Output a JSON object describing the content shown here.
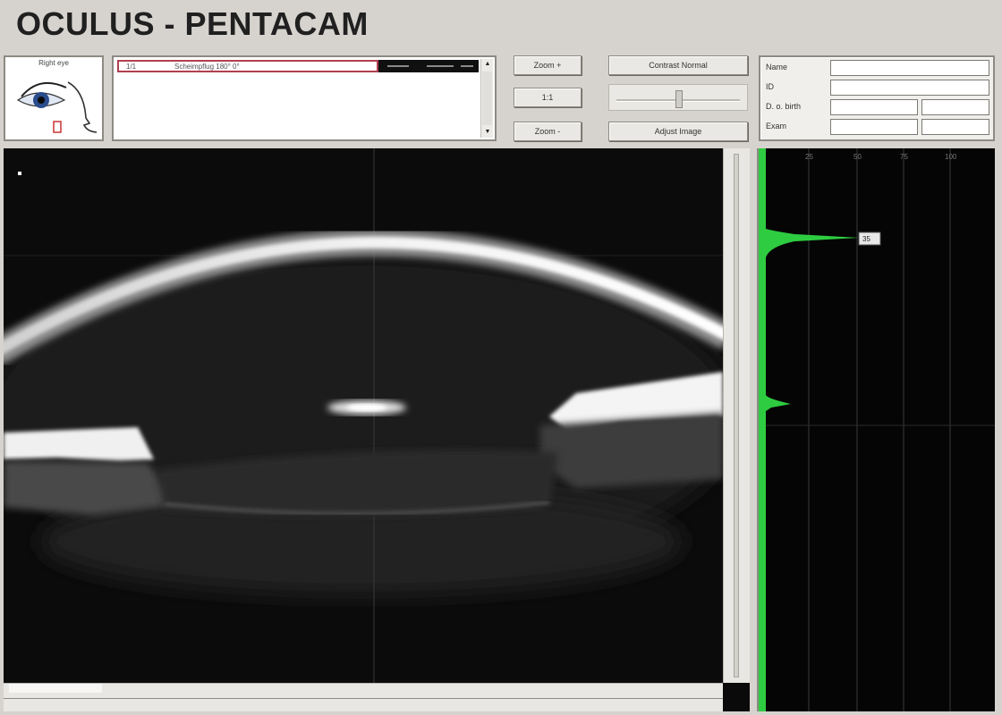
{
  "app": {
    "title": "OCULUS  -  PENTACAM"
  },
  "eye_selector": {
    "label": "Right eye"
  },
  "scan_list": {
    "rows": [
      {
        "col1": "1/1",
        "col2": "Scheimpflug  180°  0°"
      }
    ]
  },
  "toolbar": {
    "zoom_in": "Zoom +",
    "ratio": "1:1",
    "zoom_out": "Zoom -",
    "contrast": "Contrast Normal",
    "adjust": "Adjust Image"
  },
  "patient": {
    "name_label": "Name",
    "id_label": "ID",
    "dob_label": "D. o. birth",
    "exam_label": "Exam",
    "name_value": "",
    "id_value": "",
    "dob_value": "",
    "exam_value": ""
  },
  "profile": {
    "tick_labels": [
      "25",
      "50",
      "75",
      "100"
    ],
    "peak_value": "35",
    "graph_color": "#2ecc40"
  }
}
